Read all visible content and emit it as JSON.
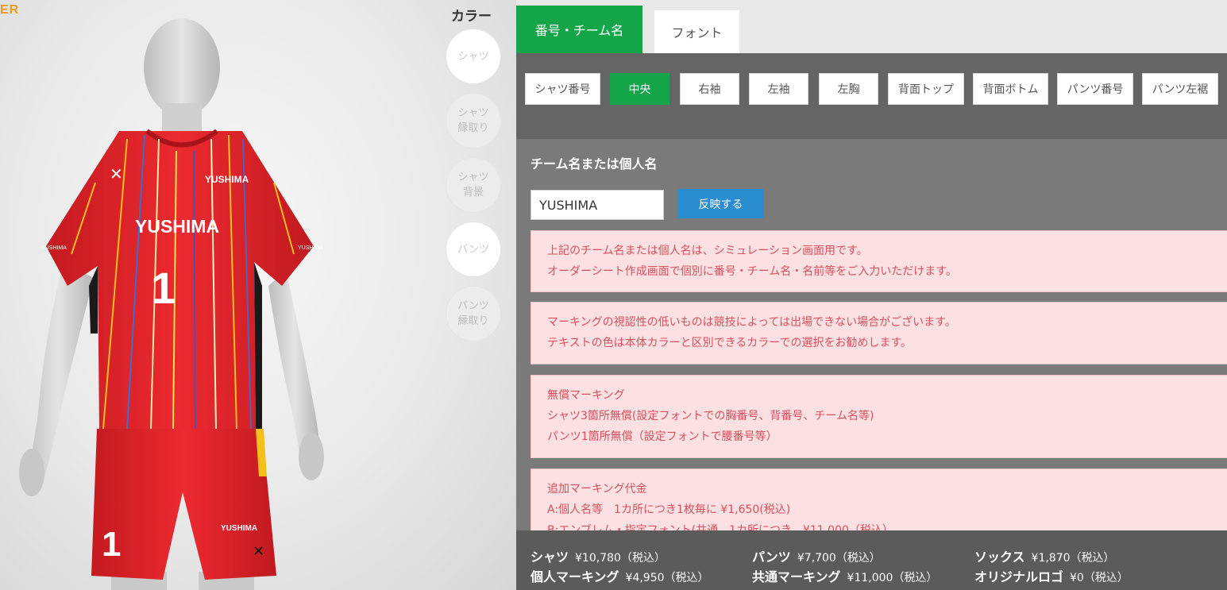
{
  "brand_logo": "ER",
  "color_panel": {
    "title": "カラー",
    "buttons": [
      {
        "label": "シャツ"
      },
      {
        "label": "シャツ\n縁取り"
      },
      {
        "label": "シャツ\n背景"
      },
      {
        "label": "パンツ"
      },
      {
        "label": "パンツ\n縁取り"
      }
    ]
  },
  "uniform": {
    "shirt_color": "#e8262c",
    "team_name_chest": "YUSHIMA",
    "team_name_small": "YUSHIMA",
    "number": "1"
  },
  "tabs": [
    {
      "label": "番号・チーム名",
      "active": true
    },
    {
      "label": "フォント",
      "active": false
    }
  ],
  "positions": [
    {
      "label": "シャツ番号"
    },
    {
      "label": "中央",
      "active": true
    },
    {
      "label": "右袖"
    },
    {
      "label": "左袖"
    },
    {
      "label": "左胸"
    },
    {
      "label": "背面トップ"
    },
    {
      "label": "背面ボトム"
    },
    {
      "label": "パンツ番号"
    },
    {
      "label": "パンツ左裾"
    }
  ],
  "team_section": {
    "label": "チーム名または個人名",
    "input_value": "YUSHIMA",
    "apply_label": "反映する"
  },
  "notices": [
    {
      "lines": [
        "上記のチーム名または個人名は、シミュレーション画面用です。",
        "オーダーシート作成画面で個別に番号・チーム名・名前等をご入力いただけます。"
      ]
    },
    {
      "lines": [
        "マーキングの視認性の低いものは競技によっては出場できない場合がございます。",
        "テキストの色は本体カラーと区別できるカラーでの選択をお勧めします。"
      ]
    },
    {
      "lines": [
        "無償マーキング",
        "シャツ3箇所無償(設定フォントでの胸番号、背番号、チーム名等)",
        "パンツ1箇所無償（設定フォントで腰番号等）"
      ]
    },
    {
      "lines": [
        "追加マーキング代金",
        "A:個人名等　1カ所につき1枚毎に ¥1,650(税込)",
        "B:エンブレム・指定フォント(共通　1カ所につき　¥11,000（税込）"
      ]
    }
  ],
  "prices": {
    "shirt": {
      "label": "シャツ",
      "value": "¥10,780（税込）"
    },
    "pants": {
      "label": "パンツ",
      "value": "¥7,700（税込）"
    },
    "socks": {
      "label": "ソックス",
      "value": "¥1,870（税込）"
    },
    "personal_marking": {
      "label": "個人マーキング",
      "value": "¥4,950（税込）"
    },
    "common_marking": {
      "label": "共通マーキング",
      "value": "¥11,000（税込）"
    },
    "original_logo": {
      "label": "オリジナルロゴ",
      "value": "¥0（税込）"
    }
  }
}
